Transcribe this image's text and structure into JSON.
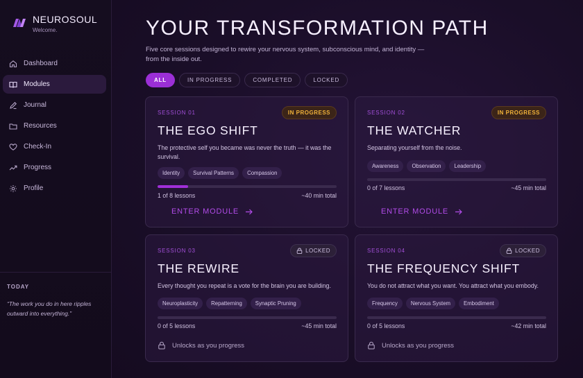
{
  "brand": {
    "name": "NEUROSOUL",
    "subtitle": "Welcome."
  },
  "nav": [
    {
      "label": "Dashboard",
      "icon": "home-icon"
    },
    {
      "label": "Modules",
      "icon": "book-icon"
    },
    {
      "label": "Journal",
      "icon": "pen-icon"
    },
    {
      "label": "Resources",
      "icon": "folder-icon"
    },
    {
      "label": "Check-In",
      "icon": "heart-icon"
    },
    {
      "label": "Progress",
      "icon": "trending-up-icon"
    },
    {
      "label": "Profile",
      "icon": "gear-icon"
    }
  ],
  "active_nav": "Modules",
  "today": {
    "label": "TODAY",
    "quote": "“The work you do in here ripples outward into everything.”"
  },
  "page": {
    "title": "YOUR TRANSFORMATION PATH",
    "subtitle": "Five core sessions designed to rewire your nervous system, subconscious mind, and identity — from the inside out."
  },
  "filters": [
    "ALL",
    "IN PROGRESS",
    "COMPLETED",
    "LOCKED"
  ],
  "active_filter": "ALL",
  "colors": {
    "accent": "#9b2fd6",
    "in_progress": "#f1b33a",
    "background": "#1a0e28"
  },
  "modules": [
    {
      "session": "SESSION 01",
      "status": "IN PROGRESS",
      "title": "THE EGO SHIFT",
      "description": "The protective self you became was never the truth — it was the survival.",
      "tags": [
        "Identity",
        "Survival Patterns",
        "Compassion"
      ],
      "lessons": "1 of 8 lessons",
      "progress": 0.17,
      "duration": "~40 min total",
      "action": "ENTER MODULE"
    },
    {
      "session": "SESSION 02",
      "status": "IN PROGRESS",
      "title": "THE WATCHER",
      "description": "Separating yourself from the noise.",
      "tags": [
        "Awareness",
        "Observation",
        "Leadership"
      ],
      "lessons": "0 of 7 lessons",
      "progress": 0,
      "duration": "~45 min total",
      "action": "ENTER MODULE"
    },
    {
      "session": "SESSION 03",
      "status": "LOCKED",
      "title": "THE REWIRE",
      "description": "Every thought you repeat is a vote for the brain you are building.",
      "tags": [
        "Neuroplasticity",
        "Repatterning",
        "Synaptic Pruning"
      ],
      "lessons": "0 of 5 lessons",
      "progress": 0,
      "duration": "~45 min total",
      "action": "Unlocks as you progress"
    },
    {
      "session": "SESSION 04",
      "status": "LOCKED",
      "title": "THE FREQUENCY SHIFT",
      "description": "You do not attract what you want. You attract what you embody.",
      "tags": [
        "Frequency",
        "Nervous System",
        "Embodiment"
      ],
      "lessons": "0 of 5 lessons",
      "progress": 0,
      "duration": "~42 min total",
      "action": "Unlocks as you progress"
    }
  ]
}
